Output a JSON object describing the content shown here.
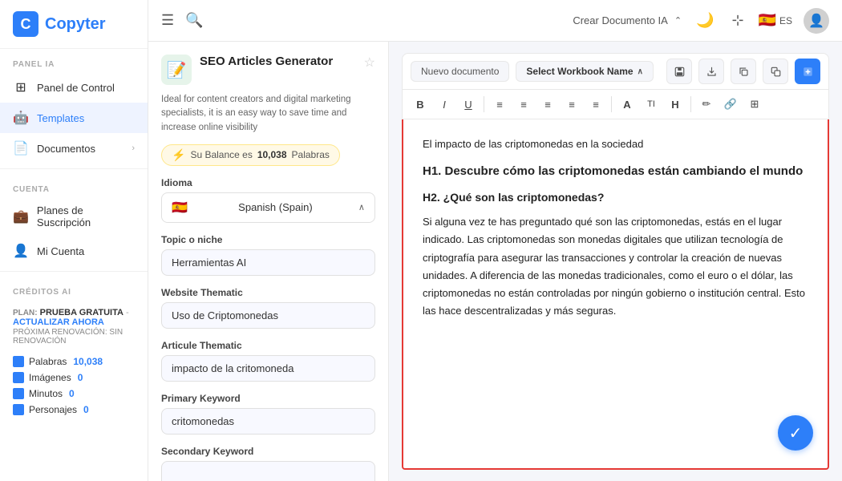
{
  "sidebar": {
    "logo_letter": "C",
    "logo_name": "Copyter",
    "panel_ia_label": "PANEL IA",
    "items_panel": [
      {
        "id": "panel",
        "label": "Panel de Control",
        "icon": "⊞"
      },
      {
        "id": "templates",
        "label": "Templates",
        "icon": "🤖",
        "active": true
      },
      {
        "id": "documentos",
        "label": "Documentos",
        "icon": "📄",
        "arrow": "›"
      }
    ],
    "cuenta_label": "CUENTA",
    "items_cuenta": [
      {
        "id": "planes",
        "label": "Planes de Suscripción",
        "icon": "💼"
      },
      {
        "id": "micuenta",
        "label": "Mi Cuenta",
        "icon": "👤"
      }
    ],
    "creditos_label": "CRÉDITOS AI",
    "plan_label": "PLAN:",
    "plan_free": "PRUEBA GRATUITA",
    "plan_update": "ACTUALIZAR AHORA",
    "proxima_label": "PRÓXIMA RENOVACIÓN: SIN RENOVACIÓN",
    "credits": [
      {
        "id": "palabras",
        "label": "Palabras",
        "value": "10,038"
      },
      {
        "id": "imagenes",
        "label": "Imágenes",
        "value": "0"
      },
      {
        "id": "minutos",
        "label": "Minutos",
        "value": "0"
      },
      {
        "id": "personajes",
        "label": "Personajes",
        "value": "0"
      }
    ]
  },
  "topbar": {
    "menu_icon": "☰",
    "search_icon": "🔍",
    "crear_label": "Crear Documento IA",
    "chevron": "⌃",
    "dark_mode_icon": "🌙",
    "expand_icon": "⊹",
    "lang": "ES",
    "flag": "🇪🇸"
  },
  "generator": {
    "icon": "📝",
    "title": "SEO Articles Generator",
    "desc": "Ideal for content creators and digital marketing specialists, it is an easy way to save time and increase online visibility",
    "balance_label": "Su Balance es",
    "balance_value": "10,038",
    "balance_unit": "Palabras",
    "fields": [
      {
        "id": "idioma",
        "label": "Idioma",
        "type": "select",
        "value": "Spanish (Spain)",
        "flag": "🇪🇸"
      },
      {
        "id": "topic",
        "label": "Topic o niche",
        "type": "text",
        "value": "Herramientas AI"
      },
      {
        "id": "website_thematic",
        "label": "Website Thematic",
        "type": "text",
        "value": "Uso de Criptomonedas"
      },
      {
        "id": "article_thematic",
        "label": "Articule Thematic",
        "type": "text",
        "value": "impacto de la critomoneda"
      },
      {
        "id": "primary_keyword",
        "label": "Primary Keyword",
        "type": "text",
        "value": "critomonedas"
      },
      {
        "id": "secondary_keyword",
        "label": "Secondary Keyword",
        "type": "text",
        "value": ""
      }
    ]
  },
  "editor": {
    "doc_selector": "Nuevo documento",
    "workbook_selector": "Select Workbook Name",
    "toolbar_buttons": [
      "B",
      "I",
      "U",
      "≡",
      "≡",
      "≡",
      "≡",
      "≡",
      "A",
      "TI",
      "H",
      "✏",
      "🔗",
      "⊞"
    ],
    "content": {
      "intro": "El impacto de las criptomonedas en la sociedad",
      "h1": "H1. Descubre cómo las criptomonedas están cambiando el mundo",
      "h2": "H2. ¿Qué son las criptomonedas?",
      "body": "Si alguna vez te has preguntado qué son las criptomonedas, estás en el lugar indicado. Las criptomonedas son monedas digitales que utilizan tecnología de criptografía para asegurar las transacciones y controlar la creación de nuevas unidades. A diferencia de las monedas tradicionales, como el euro o el dólar, las criptomonedas no están controladas por ningún gobierno o institución central. Esto las hace descentralizadas y más seguras."
    },
    "fab_icon": "✓"
  }
}
